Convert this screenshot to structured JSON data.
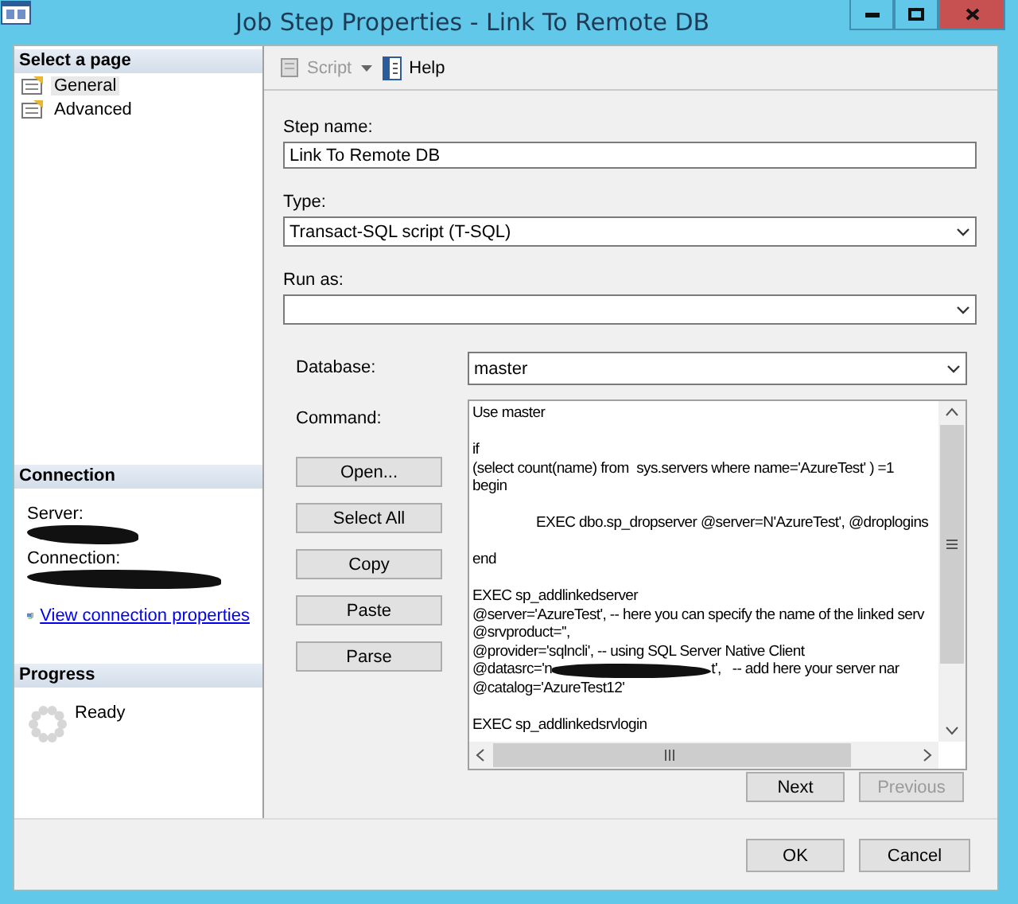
{
  "window": {
    "title": "Job Step Properties - Link To Remote DB"
  },
  "sidebar": {
    "pages_header": "Select a page",
    "pages": [
      {
        "label": "General",
        "selected": true
      },
      {
        "label": "Advanced",
        "selected": false
      }
    ],
    "connection_header": "Connection",
    "server_label": "Server:",
    "connection_label": "Connection:",
    "connection_link": "View connection properties",
    "progress_header": "Progress",
    "progress_status": "Ready"
  },
  "toolbar": {
    "script": {
      "label": "Script",
      "disabled": true
    },
    "help": {
      "label": "Help",
      "disabled": false
    }
  },
  "form": {
    "step_name": {
      "label": "Step name:",
      "value": "Link To Remote DB"
    },
    "type": {
      "label": "Type:",
      "value": "Transact-SQL script (T-SQL)"
    },
    "run_as": {
      "label": "Run as:"
    },
    "database": {
      "label": "Database:",
      "value": "master"
    },
    "command_label": "Command:",
    "command_buttons": [
      "Open...",
      "Select All",
      "Copy",
      "Paste",
      "Parse"
    ],
    "command_lines": [
      {
        "kind": "text",
        "text": "Use master"
      },
      {
        "kind": "blank"
      },
      {
        "kind": "text",
        "text": "if"
      },
      {
        "kind": "text",
        "text": "(select count(name) from  sys.servers where name='AzureTest' ) =1"
      },
      {
        "kind": "text",
        "text": "begin"
      },
      {
        "kind": "blank"
      },
      {
        "kind": "text",
        "text": "\tEXEC dbo.sp_dropserver @server=N'AzureTest', @droplogins"
      },
      {
        "kind": "blank"
      },
      {
        "kind": "text",
        "text": "end"
      },
      {
        "kind": "blank"
      },
      {
        "kind": "text",
        "text": "EXEC sp_addlinkedserver"
      },
      {
        "kind": "text",
        "text": "@server='AzureTest', -- here you can specify the name of the linked serv"
      },
      {
        "kind": "text",
        "text": "@srvproduct='',"
      },
      {
        "kind": "text",
        "text": "@provider='sqlncli', -- using SQL Server Native Client"
      },
      {
        "kind": "redacted",
        "before": "@datasrc='n",
        "after": "t',   -- add here your server nar"
      },
      {
        "kind": "text",
        "text": "@catalog='AzureTest12'"
      },
      {
        "kind": "blank"
      },
      {
        "kind": "text",
        "text": "EXEC sp_addlinkedsrvlogin"
      }
    ]
  },
  "navigation": {
    "next": {
      "label": "Next",
      "disabled": false
    },
    "previous": {
      "label": "Previous",
      "disabled": true
    }
  },
  "buttons": [
    "OK",
    "Cancel"
  ]
}
